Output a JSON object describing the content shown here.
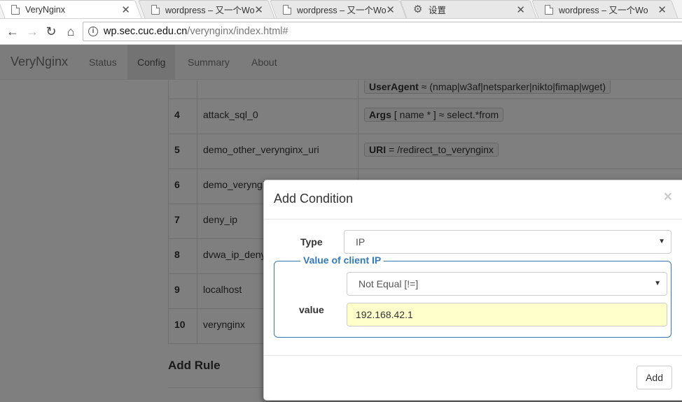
{
  "browser": {
    "tabs": [
      {
        "title": "VeryNginx",
        "icon": "page-icon",
        "active": true
      },
      {
        "title": "wordpress – 又一个Wo",
        "icon": "page-icon",
        "active": false
      },
      {
        "title": "wordpress – 又一个Wo",
        "icon": "page-icon",
        "active": false
      },
      {
        "title": "设置",
        "icon": "gear-icon",
        "active": false
      },
      {
        "title": "wordpress – 又一个Wo",
        "icon": "page-icon",
        "active": false
      }
    ],
    "url_host": "wp.sec.cuc.edu.cn",
    "url_path": "/verynginx/index.html#"
  },
  "navbar": {
    "brand": "VeryNginx",
    "links": [
      "Status",
      "Config",
      "Summary",
      "About"
    ],
    "active": "Config"
  },
  "rules": [
    {
      "num": "",
      "name": "",
      "cond_key": "UserAgent",
      "cond_val": "≈ (nmap|w3af|netsparker|nikto|fimap|wget)"
    },
    {
      "num": "4",
      "name": "attack_sql_0",
      "cond_key": "Args",
      "cond_val": "[ name * ] ≈ select.*from"
    },
    {
      "num": "5",
      "name": "demo_other_verynginx_uri",
      "cond_key": "URI",
      "cond_val": "= /redirect_to_verynginx"
    },
    {
      "num": "6",
      "name": "demo_veryngi",
      "cond_key": "",
      "cond_val": ""
    },
    {
      "num": "7",
      "name": "deny_ip",
      "cond_key": "",
      "cond_val": ""
    },
    {
      "num": "8",
      "name": "dvwa_ip_deny",
      "cond_key": "",
      "cond_val": ""
    },
    {
      "num": "9",
      "name": "localhost",
      "cond_key": "",
      "cond_val": ""
    },
    {
      "num": "10",
      "name": "verynginx",
      "cond_key": "",
      "cond_val": ""
    }
  ],
  "add_rule_heading": "Add Rule",
  "modal": {
    "title": "Add Condition",
    "close_glyph": "×",
    "type_label": "Type",
    "type_value": "IP",
    "legend": "Value of client IP",
    "operator_value": "Not Equal [!=]",
    "value_label": "value",
    "value": "192.168.42.1",
    "add_button": "Add"
  }
}
